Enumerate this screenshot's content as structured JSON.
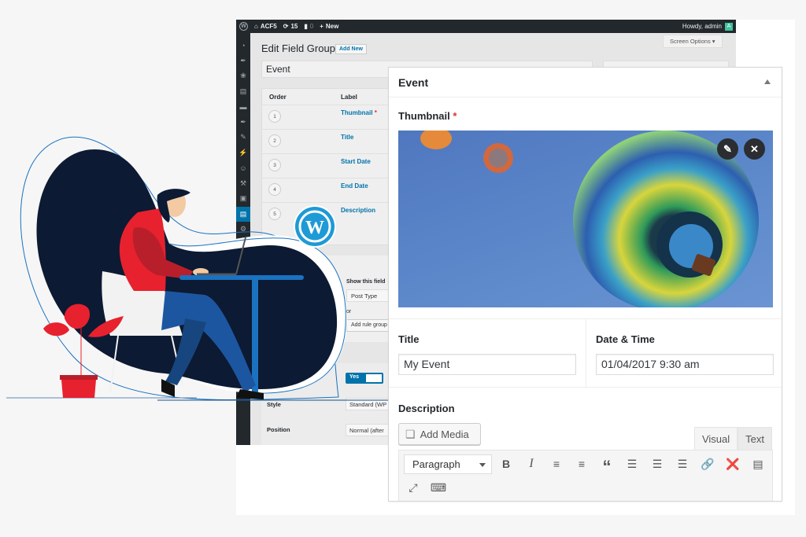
{
  "adminbar": {
    "wp_logo": "W",
    "site_name": "ACF5",
    "updates_count": "15",
    "comments_count": "0",
    "new_label": "New",
    "howdy": "Howdy, admin",
    "avatar_letter": "A"
  },
  "sidemenu": {
    "icons": [
      "dashboard-icon",
      "pin-icon",
      "media-icon",
      "pages-icon",
      "comments-icon",
      "pin-icon",
      "appearance-icon",
      "plugins-icon",
      "users-icon",
      "tools-icon",
      "settings-icon",
      "custom-fields-icon",
      "gear-icon"
    ],
    "active_index": 11
  },
  "wp_page": {
    "title": "Edit Field Group",
    "add_new": "Add New",
    "screen_options": "Screen Options ▾",
    "field_group_title": "Event",
    "fields_table": {
      "headers": [
        "Order",
        "Label"
      ],
      "rows": [
        {
          "order": "1",
          "label": "Thumbnail",
          "required": true
        },
        {
          "order": "2",
          "label": "Title",
          "required": false
        },
        {
          "order": "3",
          "label": "Start Date",
          "required": false
        },
        {
          "order": "4",
          "label": "End Date",
          "required": false
        },
        {
          "order": "5",
          "label": "Description",
          "required": false
        }
      ]
    },
    "location_rules": {
      "show_if_label": "Show this field",
      "param_value": "Post Type",
      "or_label": "or",
      "add_rule_group": "Add rule group"
    },
    "settings": {
      "active_toggle": "Yes",
      "style_label": "Style",
      "style_value": "Standard (WP",
      "position_label": "Position",
      "position_value": "Normal (after"
    }
  },
  "panel": {
    "title": "Event",
    "thumbnail_label": "Thumbnail",
    "required_mark": "*",
    "edit_icon": "✎",
    "remove_icon": "✕",
    "title_label": "Title",
    "title_value": "My Event",
    "datetime_label": "Date & Time",
    "datetime_value": "01/04/2017 9:30 am",
    "description_label": "Description",
    "add_media": "Add Media",
    "tabs": [
      {
        "label": "Visual",
        "active": true
      },
      {
        "label": "Text",
        "active": false
      }
    ],
    "format_select": "Paragraph",
    "toolbar": {
      "bold": "B",
      "italic": "I",
      "blockquote": "“"
    }
  },
  "colors": {
    "wp_blue": "#0073aa",
    "admin_dark": "#23282d",
    "navy": "#0c1a33",
    "accent_red": "#e8212e",
    "illus_blue": "#1a72c0",
    "required_red": "#dc3232"
  }
}
